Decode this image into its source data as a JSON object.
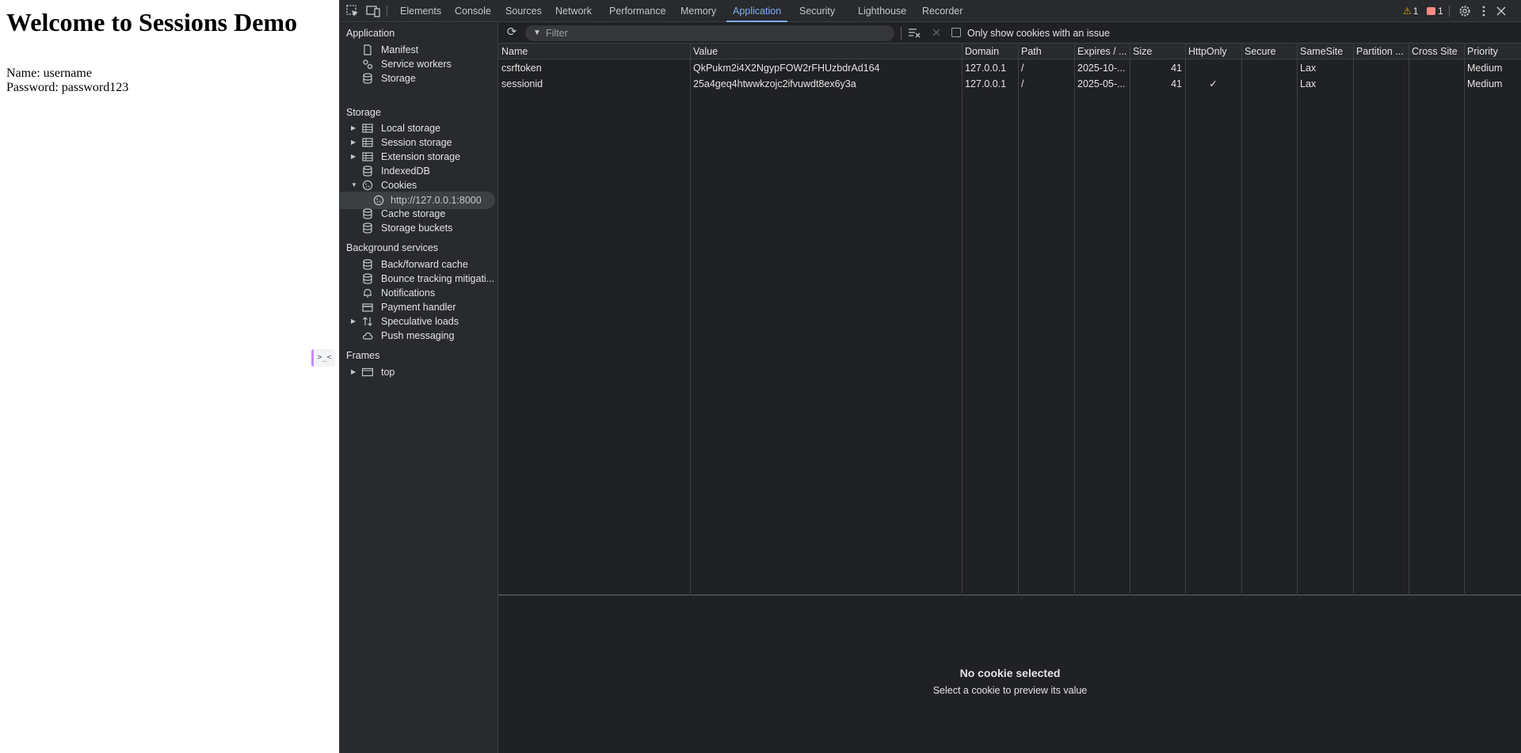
{
  "page": {
    "heading": "Welcome to Sessions Demo",
    "name_line": "Name: username",
    "password_line": "Password: password123",
    "console_toggle": ">_<"
  },
  "devtools": {
    "tabs": [
      "Elements",
      "Console",
      "Sources",
      "Network",
      "Performance",
      "Memory",
      "Application",
      "Security",
      "Lighthouse",
      "Recorder"
    ],
    "active_tab": "Application",
    "warnings_count": "1",
    "errors_count": "1",
    "colors": {
      "accent": "#7cacf8",
      "background": "#202124",
      "panel": "#282a2d",
      "warning": "#f9ab00",
      "error": "#f28b82"
    }
  },
  "sidebar": {
    "application_header": "Application",
    "application_items": [
      "Manifest",
      "Service workers",
      "Storage"
    ],
    "storage_header": "Storage",
    "storage_items": [
      "Local storage",
      "Session storage",
      "Extension storage",
      "IndexedDB",
      "Cookies"
    ],
    "cookies_origin": "http://127.0.0.1:8000",
    "storage_items_after": [
      "Cache storage",
      "Storage buckets"
    ],
    "background_header": "Background services",
    "background_items": [
      "Back/forward cache",
      "Bounce tracking mitigati...",
      "Notifications",
      "Payment handler",
      "Speculative loads",
      "Push messaging"
    ],
    "frames_header": "Frames",
    "frames_items": [
      "top"
    ]
  },
  "toolbar": {
    "filter_placeholder": "Filter",
    "only_issue_label": "Only show cookies with an issue"
  },
  "cookies_table": {
    "columns": [
      "Name",
      "Value",
      "Domain",
      "Path",
      "Expires / ...",
      "Size",
      "HttpOnly",
      "Secure",
      "SameSite",
      "Partition ...",
      "Cross Site",
      "Priority"
    ],
    "rows": [
      {
        "name": "csrftoken",
        "value": "QkPukm2i4X2NgypFOW2rFHUzbdrAd164",
        "domain": "127.0.0.1",
        "path": "/",
        "expires": "2025-10-...",
        "size": "41",
        "httponly": "",
        "secure": "",
        "samesite": "Lax",
        "partition": "",
        "cross_site": "",
        "priority": "Medium"
      },
      {
        "name": "sessionid",
        "value": "25a4geq4htwwkzojc2ifvuwdt8ex6y3a",
        "domain": "127.0.0.1",
        "path": "/",
        "expires": "2025-05-...",
        "size": "41",
        "httponly": "✓",
        "secure": "",
        "samesite": "Lax",
        "partition": "",
        "cross_site": "",
        "priority": "Medium"
      }
    ]
  },
  "preview": {
    "title": "No cookie selected",
    "subtitle": "Select a cookie to preview its value"
  }
}
